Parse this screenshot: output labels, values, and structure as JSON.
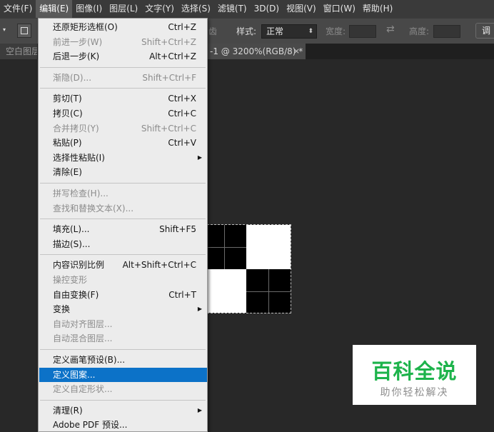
{
  "menubar": {
    "items": [
      "文件(F)",
      "编辑(E)",
      "图像(I)",
      "图层(L)",
      "文字(Y)",
      "选择(S)",
      "滤镜(T)",
      "3D(D)",
      "视图(V)",
      "窗口(W)",
      "帮助(H)"
    ],
    "active_index": 1
  },
  "options_bar": {
    "antialias_label": "齿",
    "style_label": "样式:",
    "style_value": "正常",
    "width_label": "宽度:",
    "height_label": "高度:",
    "adjust_button": "调"
  },
  "tabs": {
    "left_tab": "空白图层",
    "doc_tab": "-1 @ 3200%(RGB/8) *",
    "close_glyph": "×"
  },
  "edit_menu": {
    "items": [
      {
        "label": "还原矩形选框(O)",
        "shortcut": "Ctrl+Z",
        "disabled": false
      },
      {
        "label": "前进一步(W)",
        "shortcut": "Shift+Ctrl+Z",
        "disabled": true
      },
      {
        "label": "后退一步(K)",
        "shortcut": "Alt+Ctrl+Z",
        "disabled": false
      },
      {
        "label": "渐隐(D)...",
        "shortcut": "Shift+Ctrl+F",
        "disabled": true
      },
      {
        "label": "剪切(T)",
        "shortcut": "Ctrl+X",
        "disabled": false
      },
      {
        "label": "拷贝(C)",
        "shortcut": "Ctrl+C",
        "disabled": false
      },
      {
        "label": "合并拷贝(Y)",
        "shortcut": "Shift+Ctrl+C",
        "disabled": true
      },
      {
        "label": "粘贴(P)",
        "shortcut": "Ctrl+V",
        "disabled": false
      },
      {
        "label": "选择性粘贴(I)",
        "shortcut": "",
        "disabled": false,
        "submenu": true
      },
      {
        "label": "清除(E)",
        "shortcut": "",
        "disabled": false
      },
      {
        "label": "拼写检查(H)...",
        "shortcut": "",
        "disabled": true
      },
      {
        "label": "查找和替换文本(X)...",
        "shortcut": "",
        "disabled": true
      },
      {
        "label": "填充(L)...",
        "shortcut": "Shift+F5",
        "disabled": false
      },
      {
        "label": "描边(S)...",
        "shortcut": "",
        "disabled": false
      },
      {
        "label": "内容识别比例",
        "shortcut": "Alt+Shift+Ctrl+C",
        "disabled": false
      },
      {
        "label": "操控变形",
        "shortcut": "",
        "disabled": true
      },
      {
        "label": "自由变换(F)",
        "shortcut": "Ctrl+T",
        "disabled": false
      },
      {
        "label": "变换",
        "shortcut": "",
        "disabled": false,
        "submenu": true
      },
      {
        "label": "自动对齐图层...",
        "shortcut": "",
        "disabled": true
      },
      {
        "label": "自动混合图层...",
        "shortcut": "",
        "disabled": true
      },
      {
        "label": "定义画笔预设(B)...",
        "shortcut": "",
        "disabled": false
      },
      {
        "label": "定义图案...",
        "shortcut": "",
        "disabled": false,
        "highlighted": true
      },
      {
        "label": "定义自定形状...",
        "shortcut": "",
        "disabled": true
      },
      {
        "label": "清理(R)",
        "shortcut": "",
        "disabled": false,
        "submenu": true
      },
      {
        "label": "Adobe PDF 预设...",
        "shortcut": "",
        "disabled": false
      }
    ]
  },
  "watermark": {
    "main": "百科全说",
    "sub": "助你轻松解决"
  },
  "colors": {
    "menu_highlight": "#0c72c8",
    "watermark_green": "#1db34b"
  }
}
